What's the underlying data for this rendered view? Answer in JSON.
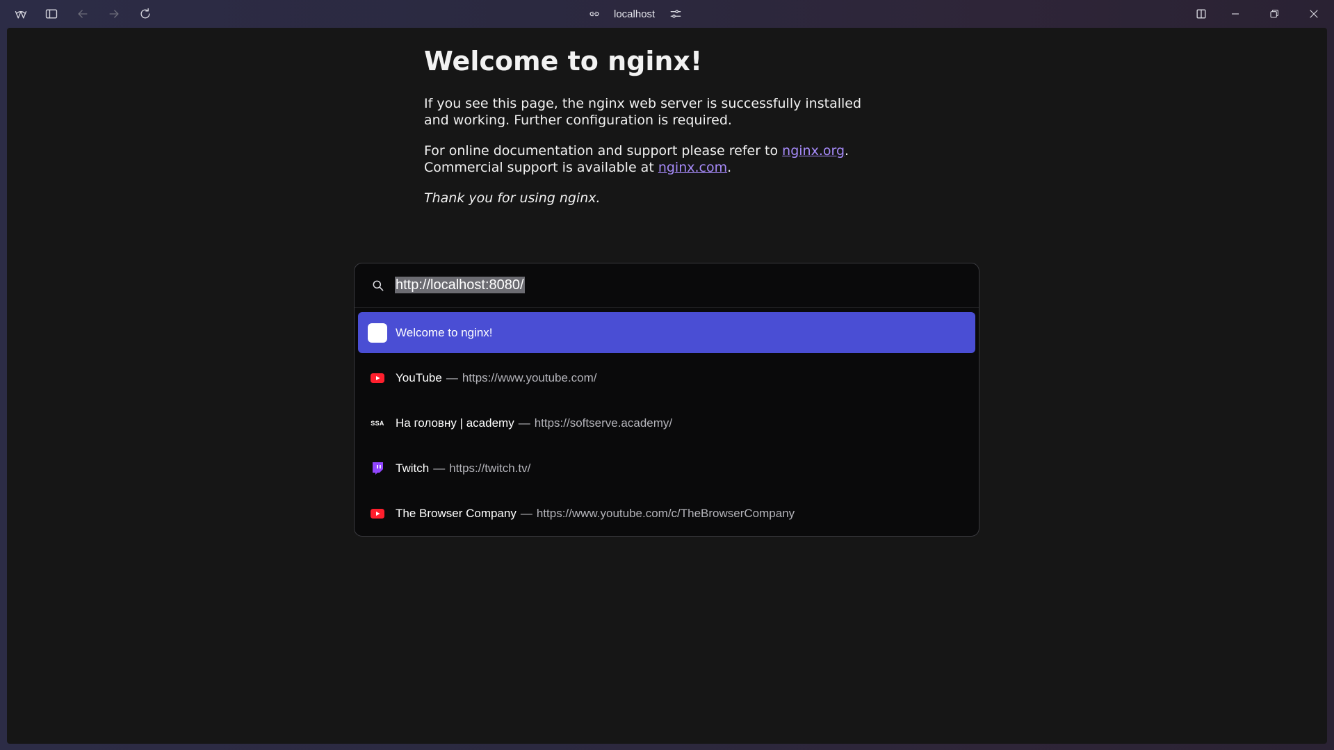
{
  "browser": {
    "address_host": "localhost",
    "icons": {
      "app": "arc-logo-icon",
      "sidebar": "sidebar-toggle-icon",
      "back": "arrow-left-icon",
      "forward": "arrow-right-icon",
      "reload": "reload-icon",
      "link": "link-icon",
      "site_settings": "tune-icon",
      "split": "split-view-icon",
      "minimize": "minimize-icon",
      "restore": "restore-icon",
      "close": "close-icon"
    }
  },
  "page": {
    "heading": "Welcome to nginx!",
    "para1": "If you see this page, the nginx web server is successfully installed and working. Further configuration is required.",
    "para2_text1": "For online documentation and support please refer to ",
    "link1": "nginx.org",
    "para2_text2": ".",
    "para2_text3": "Commercial support is available at ",
    "link2": "nginx.com",
    "para2_text4": ".",
    "thanks": "Thank you for using nginx.",
    "link_color": "#a78bfa"
  },
  "palette": {
    "search_value": "http://localhost:8080/",
    "selected_color": "#4a4ed4",
    "results": [
      {
        "title": "Welcome to nginx!",
        "url": "",
        "icon": "blank-page-icon",
        "selected": true
      },
      {
        "title": "YouTube",
        "sep": "—",
        "url": "https://www.youtube.com/",
        "icon": "youtube-icon"
      },
      {
        "title": "На головну | academy",
        "sep": "—",
        "url": "https://softserve.academy/",
        "icon": "ssa-icon",
        "icon_text": "SSA"
      },
      {
        "title": "Twitch",
        "sep": "—",
        "url": "https://twitch.tv/",
        "icon": "twitch-icon"
      },
      {
        "title": "The Browser Company",
        "sep": "—",
        "url": "https://www.youtube.com/c/TheBrowserCompany",
        "icon": "youtube-icon"
      }
    ]
  }
}
